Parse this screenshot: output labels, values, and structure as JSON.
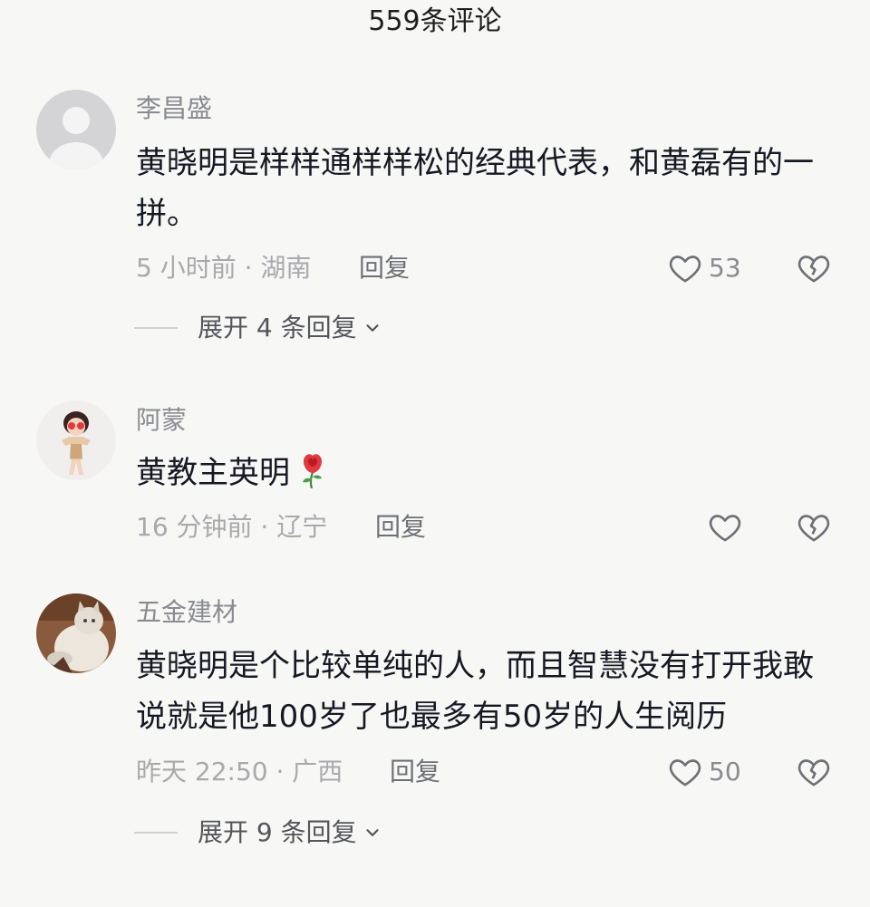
{
  "header": {
    "title": "559条评论"
  },
  "comments": [
    {
      "username": "李昌盛",
      "text": "黄晓明是样样通样样松的经典代表，和黄磊有的一拼。",
      "meta": "5 小时前 · 湖南",
      "reply_label": "回复",
      "like_count": "53",
      "expand_label": "展开 4 条回复"
    },
    {
      "username": "阿蒙",
      "text": "黄教主英明",
      "emoji": "rose-icon",
      "meta": "16 分钟前 · 辽宁",
      "reply_label": "回复",
      "like_count": ""
    },
    {
      "username": "五金建材",
      "text": "黄晓明是个比较单纯的人，而且智慧没有打开我敢说就是他100岁了也最多有50岁的人生阅历",
      "meta": "昨天 22:50 · 广西",
      "reply_label": "回复",
      "like_count": "50",
      "expand_label": "展开 9 条回复"
    }
  ],
  "icons": {
    "like": "heart-outline-icon",
    "dislike": "broken-heart-icon",
    "expand": "chevron-down-icon"
  },
  "colors": {
    "background": "#f7f7f5",
    "text_primary": "#161823",
    "text_secondary": "#8a8b91",
    "text_meta": "#a8a9ad"
  }
}
